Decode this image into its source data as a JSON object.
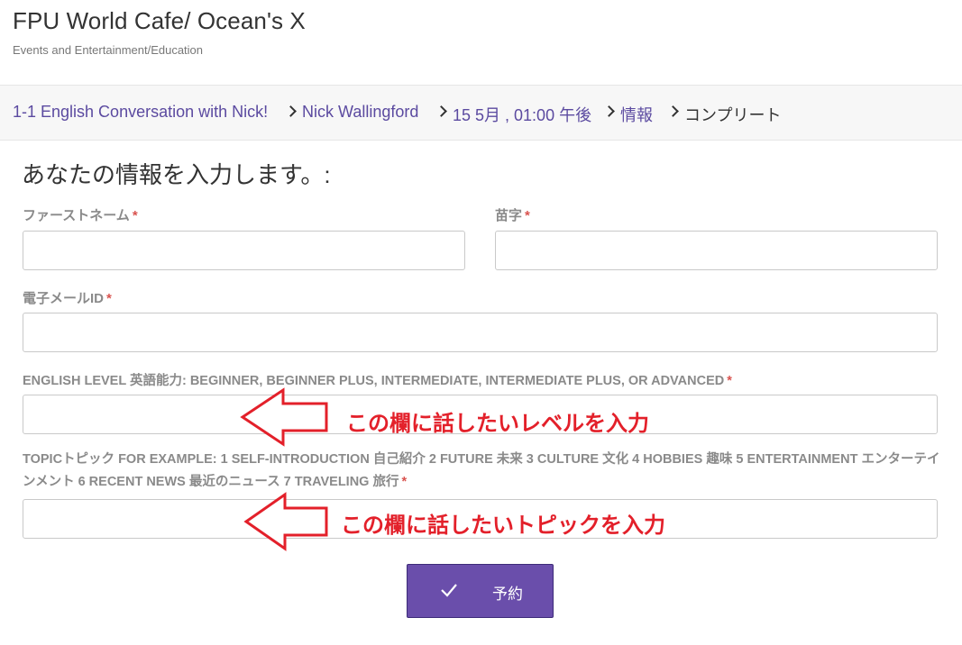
{
  "header": {
    "title": "FPU World Cafe/ Ocean's X",
    "subtitle": "Events and Entertainment/Education"
  },
  "breadcrumb": {
    "items": [
      "1-1 English Conversation with Nick!",
      "Nick Wallingford",
      "15 5月 , 01:00 午後",
      "情報",
      "コンプリート"
    ]
  },
  "form": {
    "heading": "あなたの情報を入力します。:",
    "required_mark": "*",
    "first_name_label": "ファーストネーム",
    "last_name_label": "苗字",
    "email_label": "電子メールID",
    "english_level_label": "ENGLISH LEVEL 英語能力: BEGINNER, BEGINNER PLUS, INTERMEDIATE, INTERMEDIATE PLUS, OR ADVANCED",
    "topic_label": "TOPICトピック FOR EXAMPLE: 1 SELF-INTRODUCTION 自己紹介 2 FUTURE 未来 3 CULTURE 文化 4 HOBBIES 趣味 5 ENTERTAINMENT エンターテインメント 6 RECENT NEWS 最近のニュース 7 TRAVELING 旅行",
    "first_name_value": "",
    "last_name_value": "",
    "email_value": "",
    "english_level_value": "",
    "topic_value": "",
    "submit_label": "予約"
  },
  "annotations": {
    "level_hint": "この欄に話したいレベルを入力",
    "topic_hint": "この欄に話したいトピックを入力"
  },
  "colors": {
    "accent": "#6a4eab",
    "link": "#5b4aa0",
    "annotation": "#e3202a",
    "required": "#d9534f"
  },
  "icons": {
    "separator": "chevron-right-icon",
    "submit": "checkmark-icon",
    "annotation_arrow": "arrow-left-icon"
  }
}
